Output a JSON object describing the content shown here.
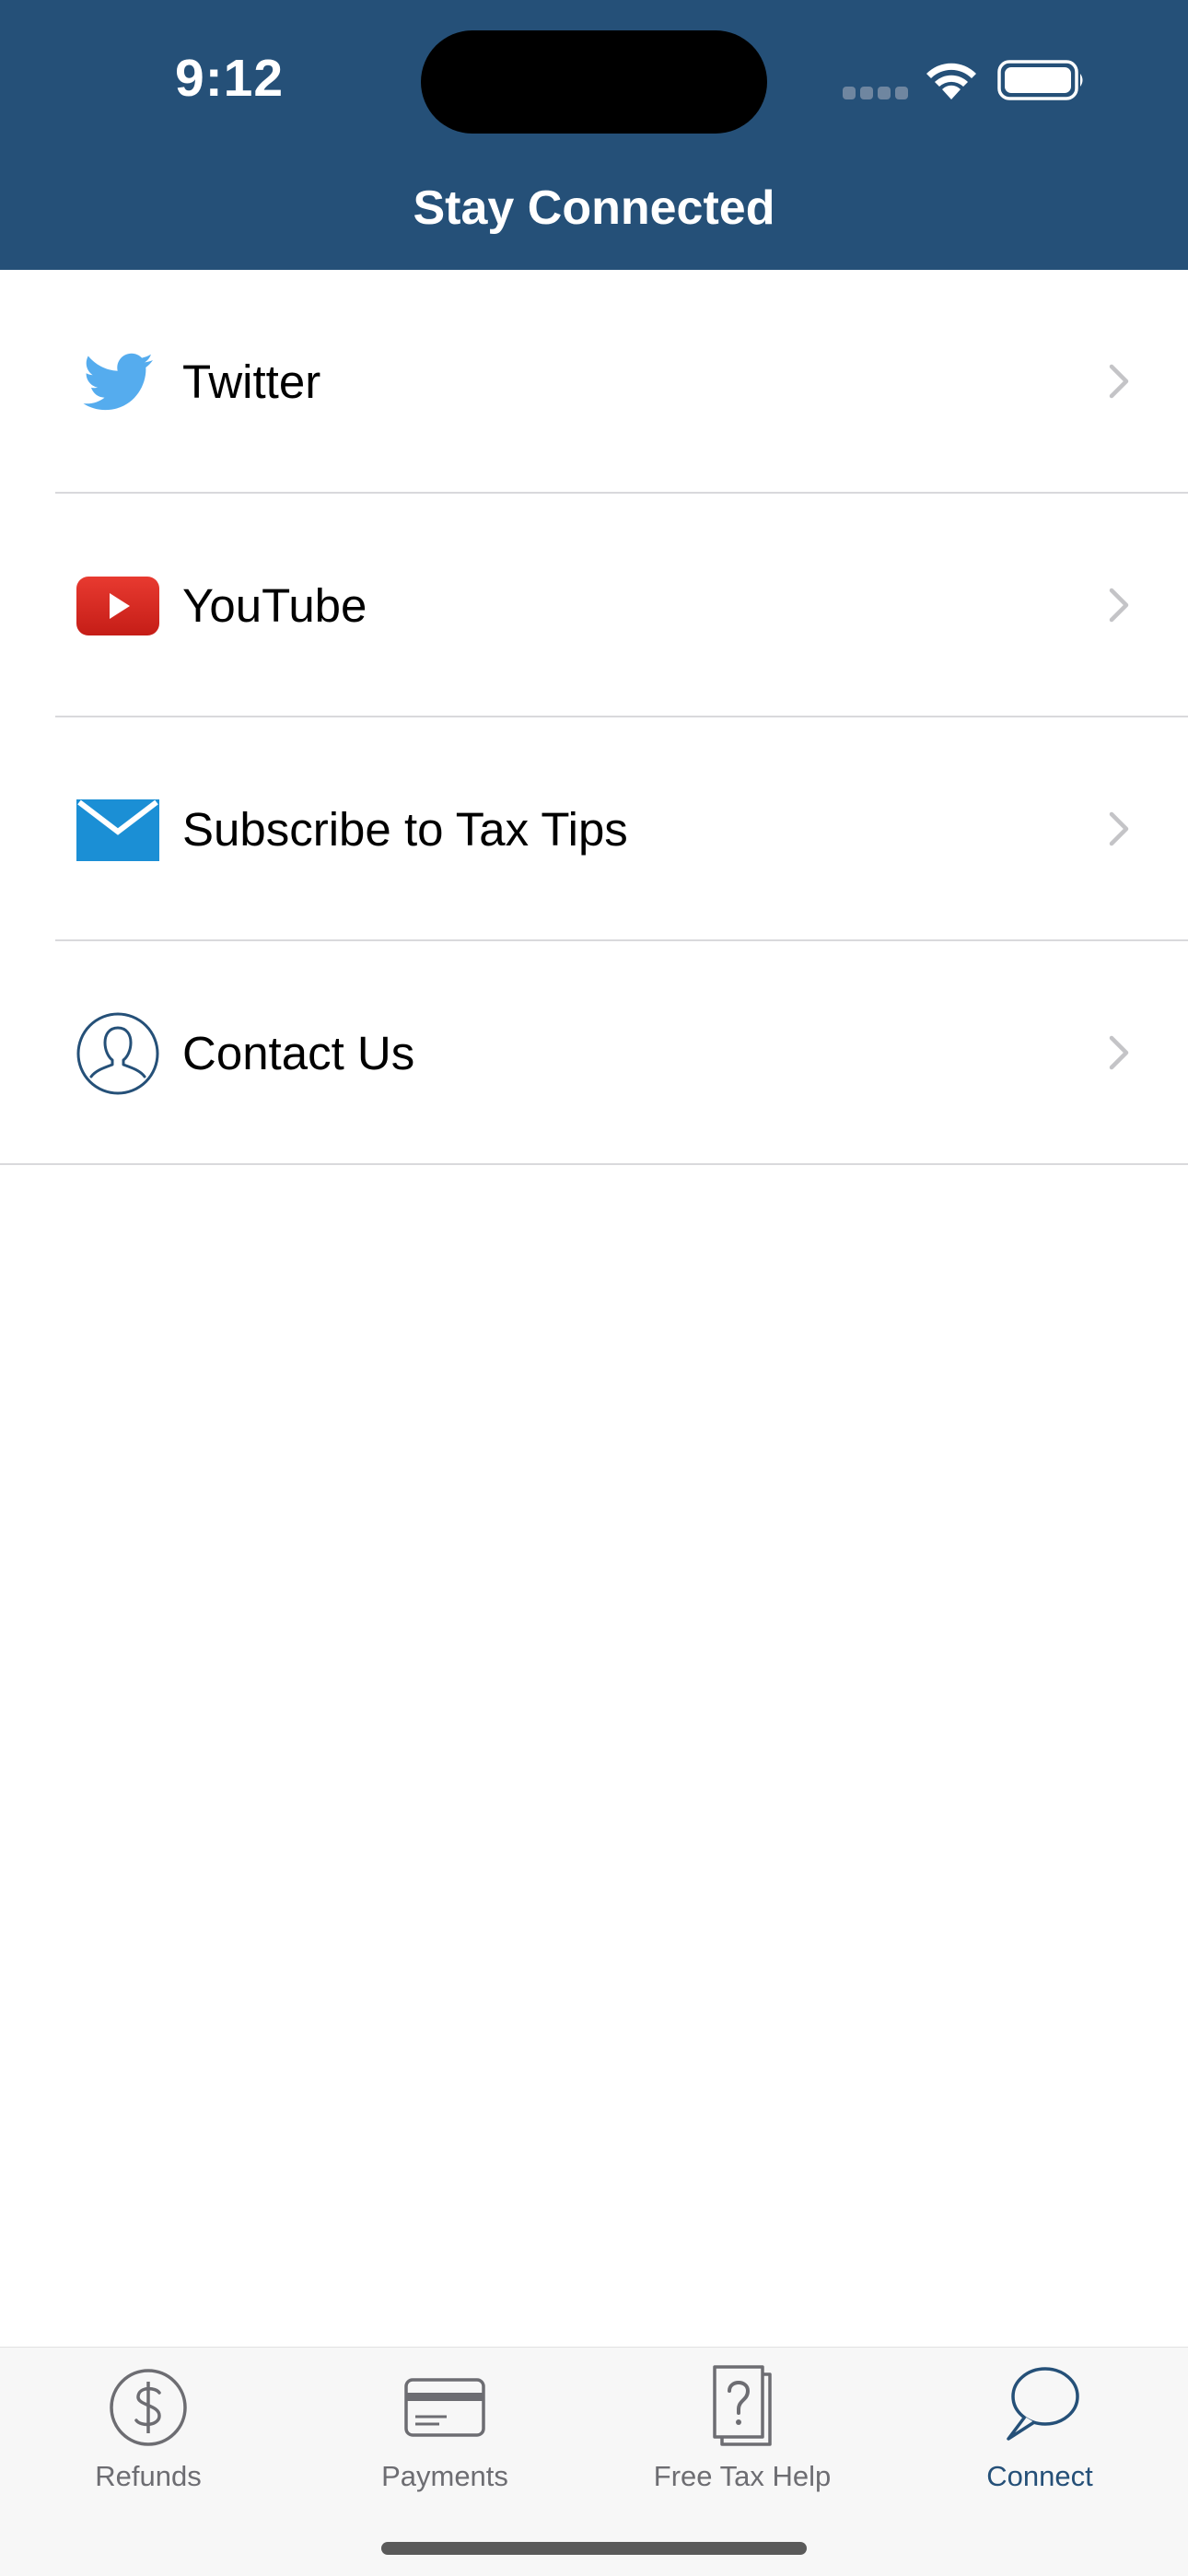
{
  "status_bar": {
    "time": "9:12"
  },
  "header": {
    "title": "Stay Connected"
  },
  "list": {
    "items": [
      {
        "label": "Twitter",
        "icon": "twitter-bird-icon"
      },
      {
        "label": "YouTube",
        "icon": "youtube-play-icon"
      },
      {
        "label": "Subscribe to Tax Tips",
        "icon": "envelope-icon"
      },
      {
        "label": "Contact Us",
        "icon": "person-outline-icon"
      }
    ]
  },
  "tab_bar": {
    "tabs": [
      {
        "label": "Refunds",
        "icon": "dollar-circle-icon",
        "active": false
      },
      {
        "label": "Payments",
        "icon": "credit-card-icon",
        "active": false
      },
      {
        "label": "Free Tax Help",
        "icon": "question-document-icon",
        "active": false
      },
      {
        "label": "Connect",
        "icon": "speech-bubble-icon",
        "active": true
      }
    ]
  },
  "colors": {
    "header_background": "#255078",
    "active_tab": "#255078",
    "inactive_tab": "#6d6d72",
    "twitter_blue": "#55acee",
    "youtube_red": "#e02a20",
    "mail_blue": "#1b8fd5"
  }
}
